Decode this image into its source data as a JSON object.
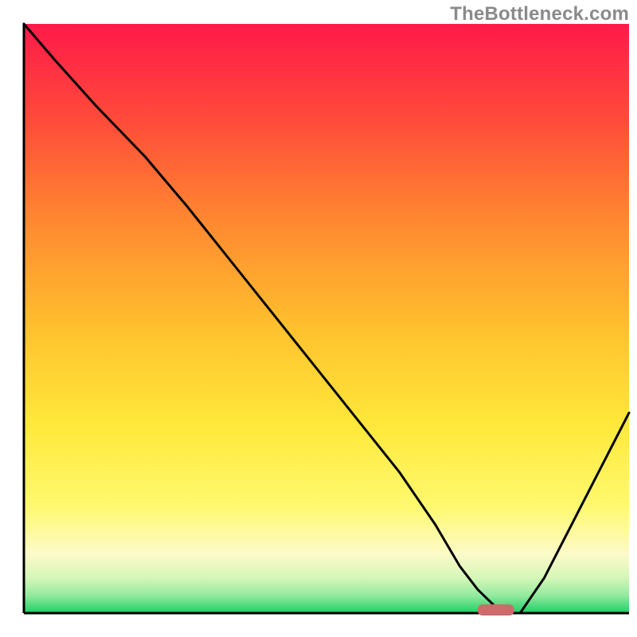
{
  "watermark": "TheBottleneck.com",
  "chart_data": {
    "type": "line",
    "title": "",
    "xlabel": "",
    "ylabel": "",
    "xlim": [
      0,
      100
    ],
    "ylim": [
      0,
      100
    ],
    "grid": false,
    "legend": null,
    "series": [
      {
        "name": "bottleneck-curve",
        "x": [
          0,
          5,
          12,
          20,
          27,
          34,
          41,
          48,
          55,
          62,
          68,
          72,
          75,
          78,
          80,
          82,
          86,
          90,
          94,
          100
        ],
        "values": [
          100,
          94,
          86,
          77.5,
          69,
          60,
          51,
          42,
          33,
          24,
          15,
          8,
          4,
          1,
          0,
          0,
          6,
          14,
          22,
          34
        ]
      }
    ],
    "marker": {
      "name": "optimal-point",
      "x": 78,
      "y": 0,
      "width": 6,
      "color": "#cf6a6a"
    },
    "gradient_bands": [
      {
        "y": 100,
        "color": "#ff1a4a"
      },
      {
        "y": 80,
        "color": "#ff5a3a"
      },
      {
        "y": 60,
        "color": "#ffa030"
      },
      {
        "y": 40,
        "color": "#ffd433"
      },
      {
        "y": 25,
        "color": "#fff060"
      },
      {
        "y": 12,
        "color": "#fdfcc0"
      },
      {
        "y": 6,
        "color": "#c8f7a8"
      },
      {
        "y": 3,
        "color": "#7fe38f"
      },
      {
        "y": 0,
        "color": "#1ecf63"
      }
    ]
  }
}
